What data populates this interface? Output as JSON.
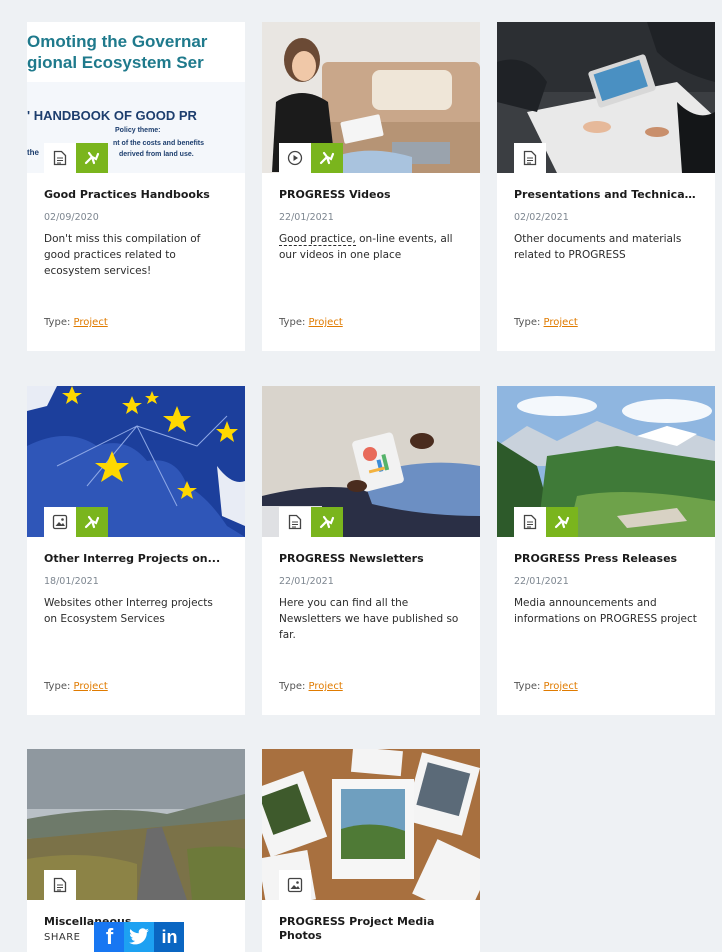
{
  "cards": [
    {
      "title": "Good Practices Handbooks",
      "date": "02/09/2020",
      "desc": "Don't miss this compilation of good practices related to ecosystem services!",
      "type_label": "Type:",
      "type_link": "Project",
      "icons": [
        "document-icon",
        "leaf-brand-icon"
      ],
      "thumb_text": {
        "line1": "Omoting the Governar",
        "line2": "gional Ecosystem Ser",
        "line3": "' HANDBOOK OF GOOD PR",
        "line4": "Policy theme:",
        "line5": "nt of the costs and benefits",
        "line6": "derived from land use.",
        "prefix": "the"
      }
    },
    {
      "title": "PROGRESS Videos",
      "date": "22/01/2021",
      "desc_prefix": "Good practice,",
      "desc": " on-line events, all our videos in one place",
      "type_label": "Type:",
      "type_link": "Project",
      "icons": [
        "play-icon",
        "leaf-brand-icon"
      ]
    },
    {
      "title": "Presentations and Technical...",
      "date": "02/02/2021",
      "desc": "Other documents and materials related to PROGRESS",
      "type_label": "Type:",
      "type_link": "Project",
      "icons": [
        "document-icon"
      ]
    },
    {
      "title": "Other Interreg Projects on...",
      "date": "18/01/2021",
      "desc": "Websites other Interreg projects on Ecosystem Services",
      "type_label": "Type:",
      "type_link": "Project",
      "icons": [
        "image-icon",
        "leaf-brand-icon"
      ]
    },
    {
      "title": "PROGRESS Newsletters",
      "date": "22/01/2021",
      "desc": "Here you can find all the Newsletters we have published so far.",
      "type_label": "Type:",
      "type_link": "Project",
      "icons": [
        "document-icon",
        "leaf-brand-icon"
      ]
    },
    {
      "title": "PROGRESS Press Releases",
      "date": "22/01/2021",
      "desc": "Media announcements and informations on PROGRESS project",
      "type_label": "Type:",
      "type_link": "Project",
      "icons": [
        "document-icon",
        "leaf-brand-icon"
      ]
    },
    {
      "title": "Miscellaneous",
      "icons": [
        "document-icon"
      ]
    },
    {
      "title": "PROGRESS Project Media Photos",
      "icons": [
        "image-icon"
      ]
    }
  ],
  "share": {
    "label": "SHARE",
    "facebook": "f",
    "twitter": "t",
    "linkedin": "in"
  },
  "colors": {
    "background": "#eef1f4",
    "accent_green": "#7ab51d",
    "link_orange": "#e07b00"
  }
}
